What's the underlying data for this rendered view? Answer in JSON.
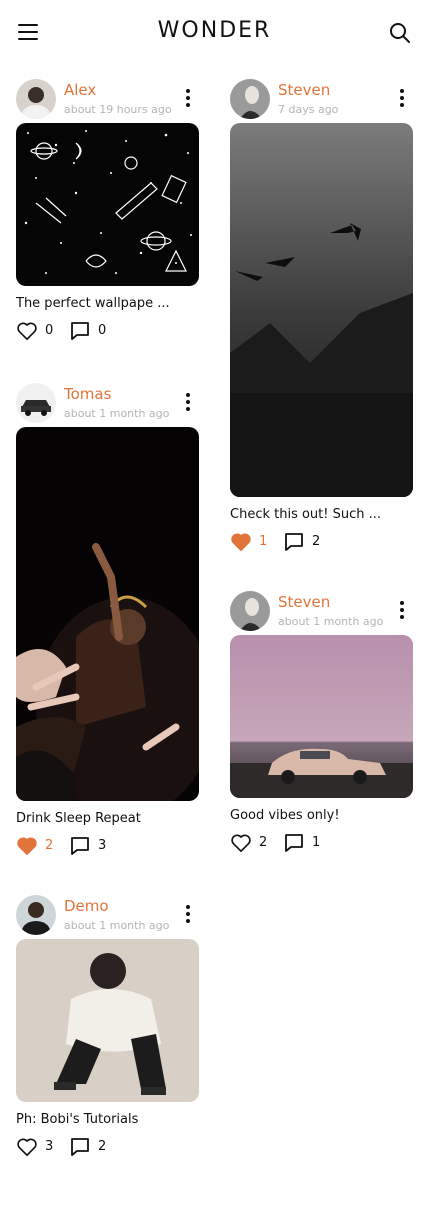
{
  "app": {
    "title": "WONDER"
  },
  "colors": {
    "accent": "#e0743a",
    "text": "#111111",
    "muted": "#b5b5b5"
  },
  "icons": {
    "menu": "hamburger-icon",
    "search": "search-icon",
    "more": "more-vertical-icon",
    "like": "heart-icon",
    "comment": "comment-icon"
  },
  "posts": [
    {
      "user": "Alex",
      "time": "about 19 hours ago",
      "caption": "The perfect wallpape ...",
      "likes": "0",
      "comments": "0",
      "liked": false
    },
    {
      "user": "Steven",
      "time": "7 days ago",
      "caption": "Check this out! Such ...",
      "likes": "1",
      "comments": "2",
      "liked": true
    },
    {
      "user": "Tomas",
      "time": "about 1 month ago",
      "caption": "Drink Sleep Repeat",
      "likes": "2",
      "comments": "3",
      "liked": true
    },
    {
      "user": "Steven",
      "time": "about 1 month ago",
      "caption": "Good vibes only!",
      "likes": "2",
      "comments": "1",
      "liked": false
    },
    {
      "user": "Demo",
      "time": "about 1 month ago",
      "caption": "Ph: Bobi's Tutorials",
      "likes": "3",
      "comments": "2",
      "liked": false
    }
  ]
}
